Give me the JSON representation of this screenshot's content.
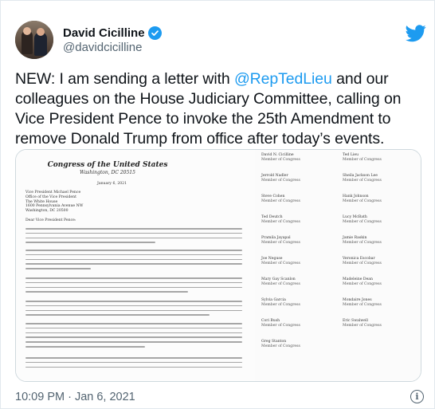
{
  "author": {
    "display_name": "David Cicilline",
    "handle": "@davidcicilline"
  },
  "tweet": {
    "text_before": "NEW: I am sending a letter with ",
    "mention": "@RepTedLieu",
    "text_after": " and our colleagues on the House Judiciary Committee, calling on Vice President Pence to invoke the 25th Amendment to remove Donald Trump from office after today’s events."
  },
  "letter": {
    "letterhead": "Congress of the United States",
    "letterhead_sub": "Washington, DC 20515",
    "date": "January 6, 2021",
    "addressee": [
      "Vice President Michael Pence",
      "Office of the Vice President",
      "The White House",
      "1600 Pennsylvania Avenue NW",
      "Washington, DC 20500"
    ],
    "salutation": "Dear Vice President Pence:",
    "signatories_left": [
      "David N. Cicilline",
      "Jerrold Nadler",
      "Steve Cohen",
      "Ted Deutch",
      "Pramila Jayapal",
      "Joe Neguse",
      "Mary Gay Scanlon",
      "Sylvia Garcia",
      "Cori Bush",
      "Greg Stanton"
    ],
    "signatories_right": [
      "Ted Lieu",
      "Sheila Jackson Lee",
      "Hank Johnson",
      "Lucy McBath",
      "Jamie Raskin",
      "Veronica Escobar",
      "Madeleine Dean",
      "Mondaire Jones",
      "Eric Swalwell"
    ],
    "role": "Member of Congress"
  },
  "footer": {
    "timestamp": "10:09 PM · Jan 6, 2021"
  },
  "icons": {
    "bird": "twitter-bird-icon",
    "verified": "verified-badge-icon",
    "info": "info-icon"
  },
  "colors": {
    "accent": "#1d9bf0",
    "text": "#0f1419",
    "muted": "#536471"
  }
}
